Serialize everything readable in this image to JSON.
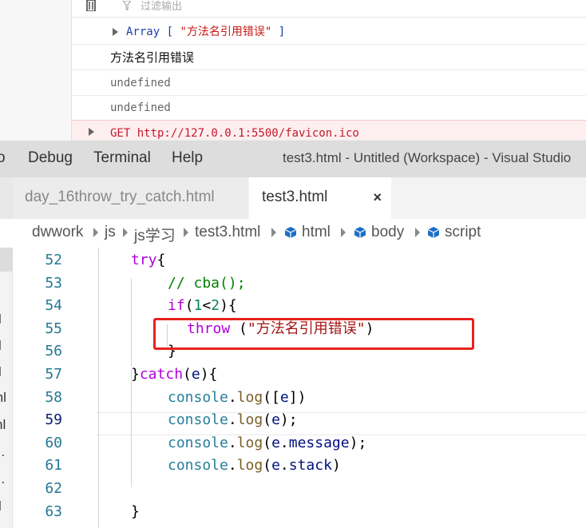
{
  "devtools": {
    "filter_placeholder": "过滤输出",
    "rows": [
      {
        "prefix": "Array [ ",
        "value": "\"方法名引用错误\"",
        "suffix": " ]"
      },
      {
        "text": "方法名引用错误"
      },
      {
        "text": "undefined"
      },
      {
        "text": "undefined"
      },
      {
        "text": "GET http://127.0.0.1:5500/favicon.ico"
      }
    ],
    "colors": {
      "error_bg": "#fdeef0",
      "error_text": "#c21a28",
      "array_text": "#1a3ea8"
    }
  },
  "vscode": {
    "menu": [
      "o",
      "Debug",
      "Terminal",
      "Help"
    ],
    "window_title": "test3.html - Untitled (Workspace) - Visual Studio",
    "tabs": [
      {
        "label": "day_16throw_try_catch.html",
        "active": false
      },
      {
        "label": "test3.html",
        "active": true,
        "close": "×"
      }
    ],
    "breadcrumb": [
      "dwwork",
      "js",
      "js学习",
      "test3.html",
      "html",
      "body",
      "script"
    ],
    "explorer_fragments": [
      "l",
      "l",
      "l",
      "ml",
      "nl",
      "...",
      "...",
      "l"
    ],
    "code_lines": [
      {
        "num": "52",
        "tokens": [
          [
            "kw",
            "try"
          ],
          [
            "pun",
            "{"
          ]
        ]
      },
      {
        "num": "53",
        "tokens": [
          [
            "cm",
            "// cba();"
          ]
        ]
      },
      {
        "num": "54",
        "tokens": [
          [
            "kw",
            "if"
          ],
          [
            "pun",
            "("
          ],
          [
            "num",
            "1"
          ],
          [
            "pun",
            "<"
          ],
          [
            "num",
            "2"
          ],
          [
            "pun",
            "){"
          ]
        ]
      },
      {
        "num": "55",
        "tokens": [
          [
            "kw",
            "throw"
          ],
          [
            "pun",
            " ("
          ],
          [
            "str",
            "\"方法名引用错误\""
          ],
          [
            "pun",
            ")"
          ]
        ]
      },
      {
        "num": "56",
        "tokens": [
          [
            "pun",
            "}"
          ]
        ]
      },
      {
        "num": "57",
        "tokens": [
          [
            "pun",
            "}"
          ],
          [
            "kw",
            "catch"
          ],
          [
            "pun",
            "("
          ],
          [
            "var",
            "e"
          ],
          [
            "pun",
            "){"
          ]
        ]
      },
      {
        "num": "58",
        "tokens": [
          [
            "obj",
            "console"
          ],
          [
            "pun",
            "."
          ],
          [
            "fn",
            "log"
          ],
          [
            "pun",
            "(["
          ],
          [
            "var",
            "e"
          ],
          [
            "pun",
            "])"
          ]
        ]
      },
      {
        "num": "59",
        "tokens": [
          [
            "obj",
            "console"
          ],
          [
            "pun",
            "."
          ],
          [
            "fn",
            "log"
          ],
          [
            "pun",
            "("
          ],
          [
            "var",
            "e"
          ],
          [
            "pun",
            ");"
          ]
        ],
        "active": true
      },
      {
        "num": "60",
        "tokens": [
          [
            "obj",
            "console"
          ],
          [
            "pun",
            "."
          ],
          [
            "fn",
            "log"
          ],
          [
            "pun",
            "("
          ],
          [
            "var",
            "e"
          ],
          [
            "pun",
            "."
          ],
          [
            "var",
            "message"
          ],
          [
            "pun",
            ");"
          ]
        ]
      },
      {
        "num": "61",
        "tokens": [
          [
            "obj",
            "console"
          ],
          [
            "pun",
            "."
          ],
          [
            "fn",
            "log"
          ],
          [
            "pun",
            "("
          ],
          [
            "var",
            "e"
          ],
          [
            "pun",
            "."
          ],
          [
            "var",
            "stack"
          ],
          [
            "pun",
            ")"
          ]
        ]
      },
      {
        "num": "62",
        "tokens": []
      },
      {
        "num": "63",
        "tokens": [
          [
            "pun",
            "}"
          ]
        ]
      }
    ],
    "colors": {
      "highlight_box": "#e8211f",
      "line_number": "#237893",
      "keyword": "#af00db",
      "string": "#a31515",
      "comment": "#008000"
    }
  }
}
